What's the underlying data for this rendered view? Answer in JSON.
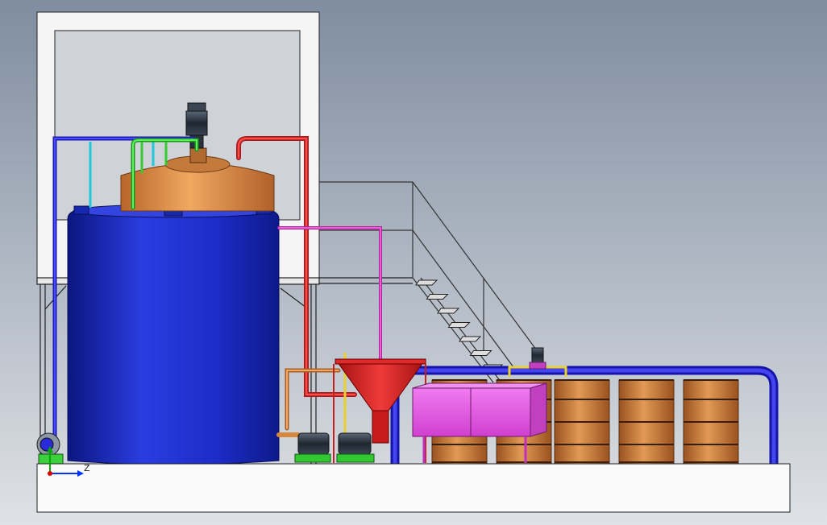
{
  "viewport": {
    "background_top": "#7f8da0",
    "background_bottom": "#dfe2e6"
  },
  "triad": {
    "axis_label": "Z",
    "x_color": "#0033ff",
    "y_color": "#00aa00",
    "origin_color": "#dd0000"
  },
  "colors": {
    "main_tank": "#1a2fd0",
    "main_tank_dark": "#0e1a8a",
    "reactor": "#d88a40",
    "drums": "#c9742e",
    "pipe_blue": "#2a2ad8",
    "pipe_red": "#e02828",
    "pipe_green": "#33cc33",
    "pipe_magenta": "#e040c8",
    "pipe_cyan": "#22c8d8",
    "pipe_orange": "#d8883a",
    "hopper": "#d81c1c",
    "tank_box": "#e060e0",
    "motor": "#2f3a48",
    "base_plate": "#fafafa",
    "structure": "#333333"
  }
}
